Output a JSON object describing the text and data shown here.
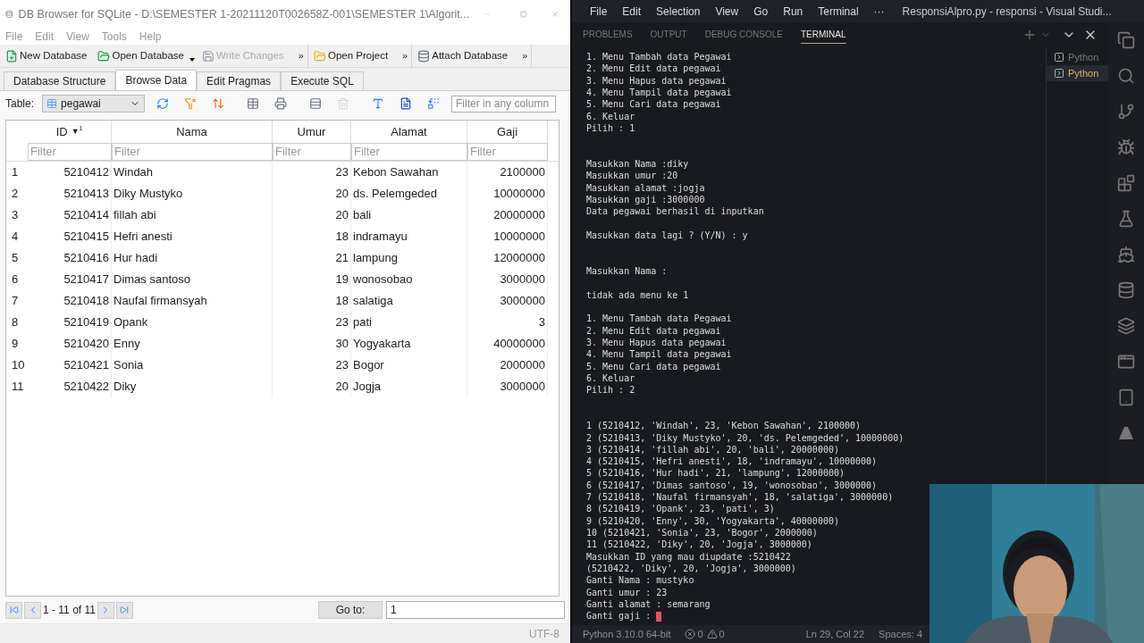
{
  "db_window": {
    "title": "DB Browser for SQLite - D:\\SEMESTER 1-20211120T002658Z-001\\SEMESTER 1\\Algorit...",
    "menu": [
      "File",
      "Edit",
      "View",
      "Tools",
      "Help"
    ],
    "toolbar_groups": [
      {
        "overflow": "»",
        "buttons": [
          {
            "label": "New Database",
            "kind": "new",
            "disabled": false,
            "dropdown": false
          },
          {
            "label": "Open Database",
            "kind": "open",
            "disabled": false,
            "dropdown": true
          },
          {
            "label": "Write Changes",
            "kind": "write",
            "disabled": true,
            "dropdown": false
          }
        ]
      },
      {
        "overflow": "»",
        "buttons": [
          {
            "label": "Open Project",
            "kind": "project",
            "disabled": false,
            "dropdown": false
          }
        ]
      },
      {
        "overflow": "»",
        "buttons": [
          {
            "label": "Attach Database",
            "kind": "attach",
            "disabled": false,
            "dropdown": false
          }
        ]
      }
    ],
    "tabs": [
      {
        "label": "Database Structure",
        "selected": false
      },
      {
        "label": "Browse Data",
        "selected": true
      },
      {
        "label": "Edit Pragmas",
        "selected": false
      },
      {
        "label": "Execute SQL",
        "selected": false
      }
    ],
    "table_label": "Table:",
    "table_select": "pegawai",
    "filter_placeholder": "Filter in any column",
    "columns": [
      {
        "label": "ID",
        "sort": "▼$^{1}$",
        "numeric": true,
        "placeholder": "Filter"
      },
      {
        "label": "Nama",
        "numeric": false,
        "placeholder": "Filter"
      },
      {
        "label": "Umur",
        "numeric": true,
        "placeholder": "Filter"
      },
      {
        "label": "Alamat",
        "numeric": false,
        "placeholder": "Filter"
      },
      {
        "label": "Gaji",
        "numeric": true,
        "placeholder": "Filter"
      }
    ],
    "rows": [
      {
        "number": "1",
        "cells": [
          "5210412",
          "Windah",
          "23",
          "Kebon Sawahan",
          "2100000"
        ]
      },
      {
        "number": "2",
        "cells": [
          "5210413",
          "Diky Mustyko",
          "20",
          "ds. Pelemgeded",
          "10000000"
        ]
      },
      {
        "number": "3",
        "cells": [
          "5210414",
          "fillah abi",
          "20",
          "bali",
          "20000000"
        ]
      },
      {
        "number": "4",
        "cells": [
          "5210415",
          "Hefri anesti",
          "18",
          "indramayu",
          "10000000"
        ]
      },
      {
        "number": "5",
        "cells": [
          "5210416",
          "Hur hadi",
          "21",
          "lampung",
          "12000000"
        ]
      },
      {
        "number": "6",
        "cells": [
          "5210417",
          "Dimas santoso",
          "19",
          "wonosobao",
          "3000000"
        ]
      },
      {
        "number": "7",
        "cells": [
          "5210418",
          "Naufal firmansyah",
          "18",
          "salatiga",
          "3000000"
        ]
      },
      {
        "number": "8",
        "cells": [
          "5210419",
          "Opank",
          "23",
          "pati",
          "3"
        ]
      },
      {
        "number": "9",
        "cells": [
          "5210420",
          "Enny",
          "30",
          "Yogyakarta",
          "40000000"
        ]
      },
      {
        "number": "10",
        "cells": [
          "5210421",
          "Sonia",
          "23",
          "Bogor",
          "2000000"
        ]
      },
      {
        "number": "11",
        "cells": [
          "5210422",
          "Diky",
          "20",
          "Jogja",
          "3000000"
        ]
      }
    ],
    "pager": {
      "range": "1 - 11 of 11",
      "goto_label": "Go to:",
      "goto_value": "1"
    },
    "status": "UTF-8"
  },
  "vscode": {
    "menu": [
      "File",
      "Edit",
      "Selection",
      "View",
      "Go",
      "Run",
      "Terminal",
      "···"
    ],
    "title": "ResponsiAlpro.py - responsi - Visual Studi...",
    "panel_tabs": [
      {
        "label": "PROBLEMS",
        "selected": false
      },
      {
        "label": "OUTPUT",
        "selected": false
      },
      {
        "label": "DEBUG CONSOLE",
        "selected": false
      },
      {
        "label": "TERMINAL",
        "selected": true
      }
    ],
    "terminal_blocks": [
      {
        "wide_gap": true,
        "lines": [
          "1. Menu Tambah data Pegawai",
          "2. Menu Edit data pegawai",
          "3. Menu Hapus data pegawai",
          "4. Menu Tampil data pegawai",
          "5. Menu Cari data pegawai",
          "6. Keluar",
          "Pilih : 1"
        ]
      },
      {
        "wide_gap": false,
        "lines": [
          "Masukkan Nama :diky",
          "Masukkan umur :20",
          "Masukkan alamat :jogja",
          "Masukkan gaji :3000000",
          "Data pegawai berhasil di inputkan"
        ]
      },
      {
        "wide_gap": true,
        "lines": [
          "Masukkan data lagi ? (Y/N) : y"
        ]
      },
      {
        "wide_gap": false,
        "lines": [
          "Masukkan Nama :"
        ]
      },
      {
        "wide_gap": false,
        "lines": [
          "tidak ada menu ke 1"
        ]
      },
      {
        "wide_gap": true,
        "lines": [
          "1. Menu Tambah data Pegawai",
          "2. Menu Edit data pegawai",
          "3. Menu Hapus data pegawai",
          "4. Menu Tampil data pegawai",
          "5. Menu Cari data pegawai",
          "6. Keluar",
          "Pilih : 2"
        ]
      },
      {
        "wide_gap": false,
        "lines": [
          "1 (5210412, 'Windah', 23, 'Kebon Sawahan', 2100000)",
          "2 (5210413, 'Diky Mustyko', 20, 'ds. Pelemgeded', 10000000)",
          "3 (5210414, 'fillah abi', 20, 'bali', 20000000)",
          "4 (5210415, 'Hefri anesti', 18, 'indramayu', 10000000)",
          "5 (5210416, 'Hur hadi', 21, 'lampung', 12000000)",
          "6 (5210417, 'Dimas santoso', 19, 'wonosobao', 3000000)",
          "7 (5210418, 'Naufal firmansyah', 18, 'salatiga', 3000000)",
          "8 (5210419, 'Opank', 23, 'pati', 3)",
          "9 (5210420, 'Enny', 30, 'Yogyakarta', 40000000)",
          "10 (5210421, 'Sonia', 23, 'Bogor', 2000000)",
          "11 (5210422, 'Diky', 20, 'Jogja', 3000000)",
          "Masukkan ID yang mau diupdate :5210422",
          "(5210422, 'Diky', 20, 'Jogja', 3000000)",
          "Ganti Nama : mustyko",
          "Ganti umur : 23",
          "Ganti alamat : semarang"
        ]
      }
    ],
    "prompt": "Ganti gaji :",
    "terminals": [
      {
        "label": "Python",
        "selected": false
      },
      {
        "label": "Python",
        "selected": true
      }
    ],
    "status": {
      "interpreter": "Python 3.10.0 64-bit",
      "errors": "0",
      "warnings": "0",
      "position": "Ln 29, Col 22",
      "spaces": "Spaces: 4"
    }
  }
}
